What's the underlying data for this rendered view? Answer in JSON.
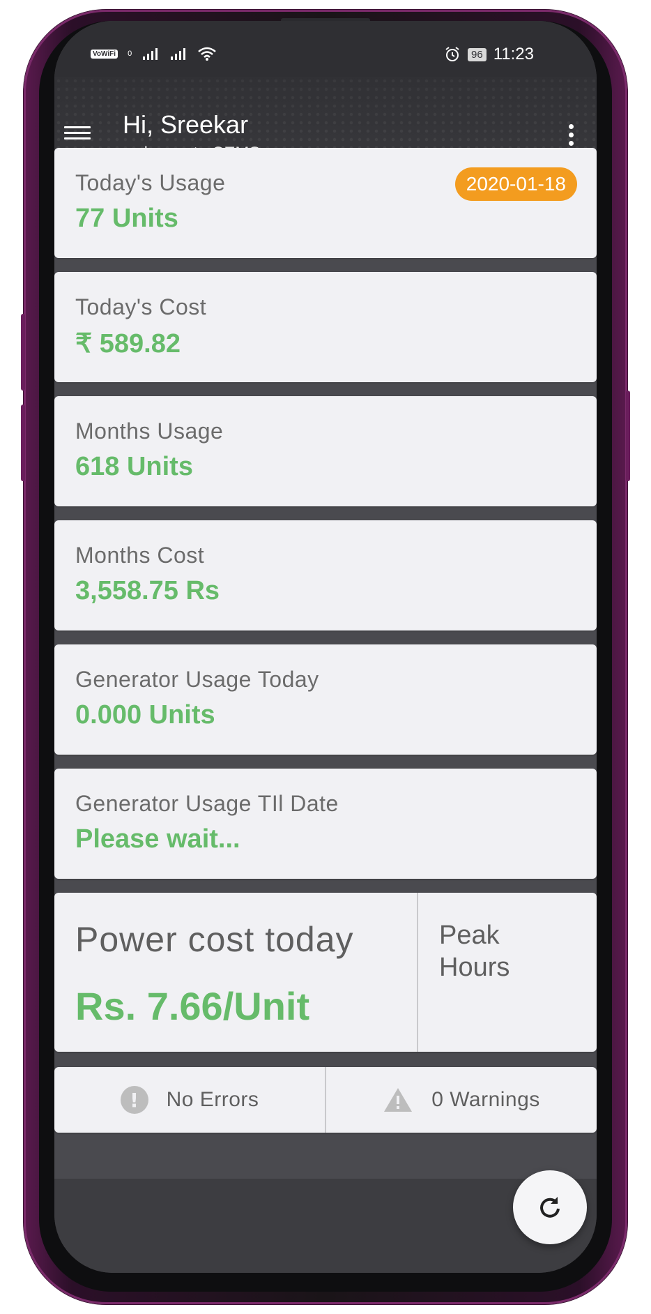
{
  "status_bar": {
    "vowifi": "VoWiFi",
    "sim": "0",
    "battery": "96",
    "time": "11:23"
  },
  "appbar": {
    "greeting": "Hi, Sreekar",
    "subtitle": "welcome to CEMS"
  },
  "cards": [
    {
      "label": "Today's Usage",
      "value": "77 Units",
      "badge": "2020-01-18"
    },
    {
      "label": "Today's Cost",
      "value": "₹ 589.82"
    },
    {
      "label": "Months Usage",
      "value": "618 Units"
    },
    {
      "label": "Months Cost",
      "value": "3,558.75 Rs"
    },
    {
      "label": "Generator Usage Today",
      "value": "0.000 Units"
    },
    {
      "label": "Generator Usage TIl Date",
      "value": "Please wait..."
    }
  ],
  "power": {
    "title": "Power cost today",
    "rate": "Rs. 7.66/Unit",
    "period": "Peak Hours"
  },
  "alerts": {
    "errors": "No Errors",
    "warnings": "0 Warnings"
  },
  "colors": {
    "accent_green": "#66bb6a",
    "badge_orange": "#f39c1f"
  }
}
